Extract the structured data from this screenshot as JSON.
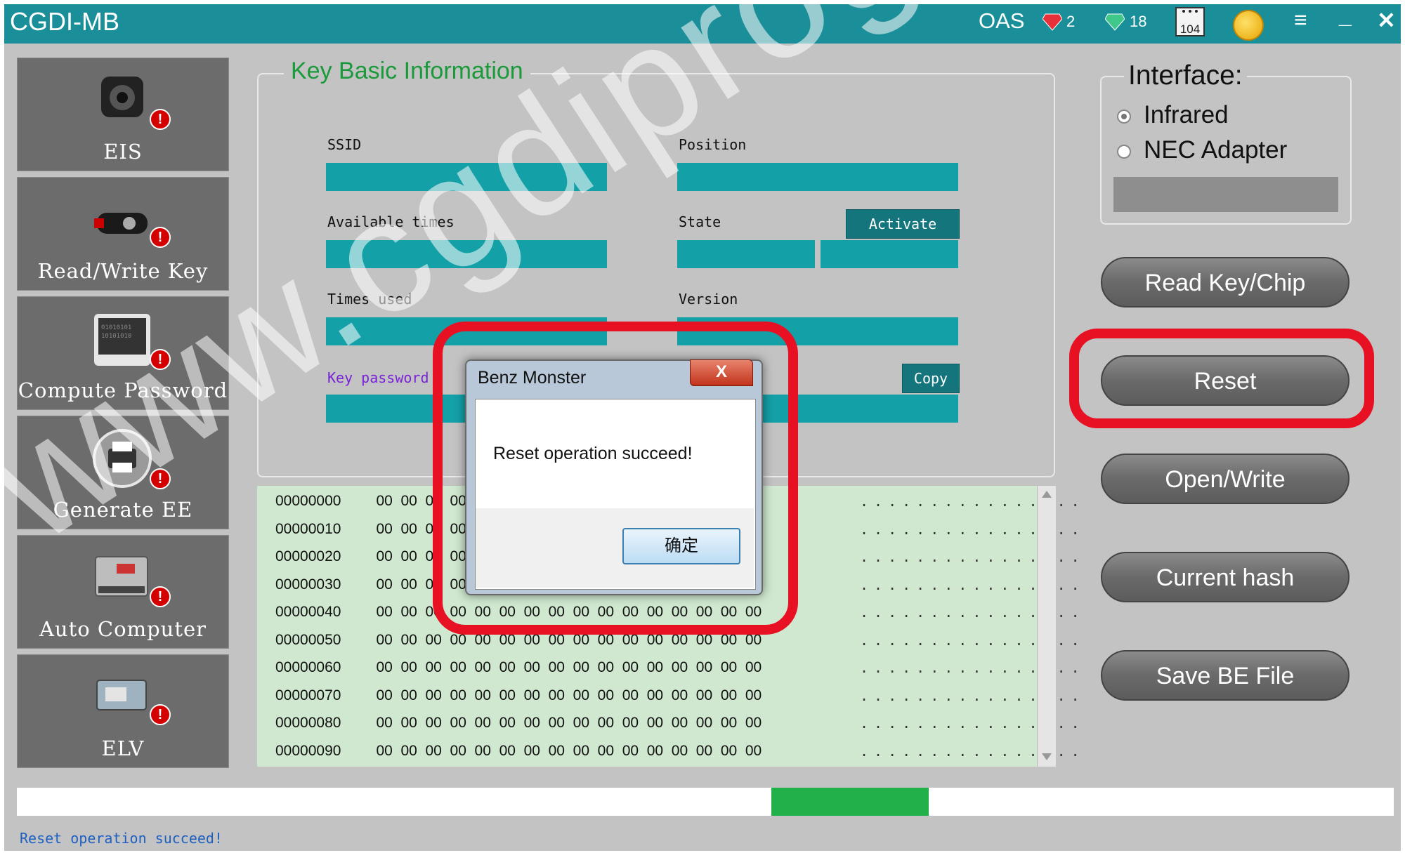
{
  "titlebar": {
    "app_title": "CGDI-MB",
    "oas": "OAS",
    "red_gems": "2",
    "green_gems": "18",
    "chip_count": "104",
    "menu_glyph": "≡",
    "minimize_glyph": "_",
    "close_glyph": "✕"
  },
  "sidebar": {
    "items": [
      {
        "label": "EIS",
        "icon": "ignition-icon"
      },
      {
        "label": "Read/Write Key",
        "icon": "key-icon"
      },
      {
        "label": "Compute Password",
        "icon": "binary-screen-icon"
      },
      {
        "label": "Generate EE",
        "icon": "printer-icon"
      },
      {
        "label": "Auto Computer",
        "icon": "ecu-icon"
      },
      {
        "label": "ELV",
        "icon": "steering-lock-icon"
      }
    ],
    "warning_glyph": "!"
  },
  "key_info": {
    "title": "Key Basic Information",
    "ssid_label": "SSID",
    "position_label": "Position",
    "available_label": "Available times",
    "state_label": "State",
    "activate_button": "Activate",
    "times_used_label": "Times used",
    "version_label": "Version",
    "key_password_label": "Key password",
    "copy_button": "Copy"
  },
  "hex_dump": {
    "rows": [
      {
        "addr": "00000000",
        "bytes": "00  00  00  00  00  00  00  00  00  00  00  00  00  00  00  00",
        "ascii": "................"
      },
      {
        "addr": "00000010",
        "bytes": "00  00  00  00  00  00  00  00  00  00  00  00  00  00  00  00",
        "ascii": "................"
      },
      {
        "addr": "00000020",
        "bytes": "00  00  00  00  00  00  00  00  00  00  00  00  00  00  00  00",
        "ascii": "................"
      },
      {
        "addr": "00000030",
        "bytes": "00  00  00  00  00  00  00  00  00  00  00  00  00  00  00  00",
        "ascii": "................"
      },
      {
        "addr": "00000040",
        "bytes": "00  00  00  00  00  00  00  00  00  00  00  00  00  00  00  00",
        "ascii": "................"
      },
      {
        "addr": "00000050",
        "bytes": "00  00  00  00  00  00  00  00  00  00  00  00  00  00  00  00",
        "ascii": "................"
      },
      {
        "addr": "00000060",
        "bytes": "00  00  00  00  00  00  00  00  00  00  00  00  00  00  00  00",
        "ascii": "................"
      },
      {
        "addr": "00000070",
        "bytes": "00  00  00  00  00  00  00  00  00  00  00  00  00  00  00  00",
        "ascii": "................"
      },
      {
        "addr": "00000080",
        "bytes": "00  00  00  00  00  00  00  00  00  00  00  00  00  00  00  00",
        "ascii": "................"
      },
      {
        "addr": "00000090",
        "bytes": "00  00  00  00  00  00  00  00  00  00  00  00  00  00  00  00",
        "ascii": "................"
      }
    ]
  },
  "interface": {
    "title": "Interface:",
    "options": [
      {
        "label": "Infrared",
        "selected": true
      },
      {
        "label": "NEC Adapter",
        "selected": false
      }
    ]
  },
  "actions": {
    "read_key": "Read Key/Chip",
    "reset": "Reset",
    "open_write": "Open/Write",
    "current_hash": "Current hash",
    "save_be": "Save BE File"
  },
  "dialog": {
    "title": "Benz Monster",
    "close_glyph": "X",
    "message": "Reset operation succeed!",
    "ok_button": "确定"
  },
  "progress": {
    "fraction": 0.114
  },
  "status_text": "Reset  operation  succeed!",
  "watermark": "www.cgdiprog.com",
  "colors": {
    "titlebar": "#1b8f99",
    "field": "#14a0a7",
    "highlight": "#e81123",
    "progress": "#22b04a"
  }
}
